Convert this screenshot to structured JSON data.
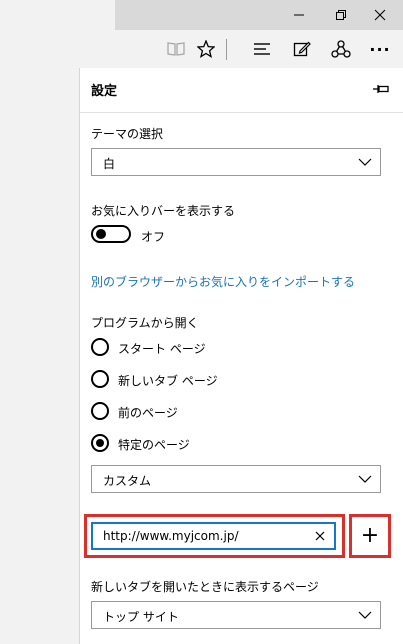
{
  "window": {
    "minimize_icon": "minimize-icon",
    "restore_icon": "restore-icon",
    "close_icon": "close-icon"
  },
  "toolbar": {
    "icons": [
      "reading-view-icon",
      "favorite-star-icon",
      "hub-icon",
      "web-note-icon",
      "share-icon",
      "more-icon"
    ],
    "more_label": "···"
  },
  "settings": {
    "title": "設定",
    "pin_icon": "pin-icon",
    "theme": {
      "label": "テーマの選択",
      "value": "白"
    },
    "favbar": {
      "label": "お気に入りバーを表示する",
      "state": "オフ"
    },
    "import_link": "別のブラウザーからお気に入りをインポートする",
    "open_with": {
      "label": "プログラムから開く",
      "options": [
        "スタート ページ",
        "新しいタブ ページ",
        "前のページ",
        "特定のページ"
      ],
      "selected_index": 3,
      "select_value": "カスタム"
    },
    "url": {
      "value": "http://www.myjcom.jp/"
    },
    "add_label": "+",
    "newtab": {
      "label": "新しいタブを開いたときに表示するページ",
      "value": "トップ サイト"
    }
  },
  "colors": {
    "accent": "#1777c7",
    "link": "#1a73b8",
    "highlight": "#d9302b"
  }
}
